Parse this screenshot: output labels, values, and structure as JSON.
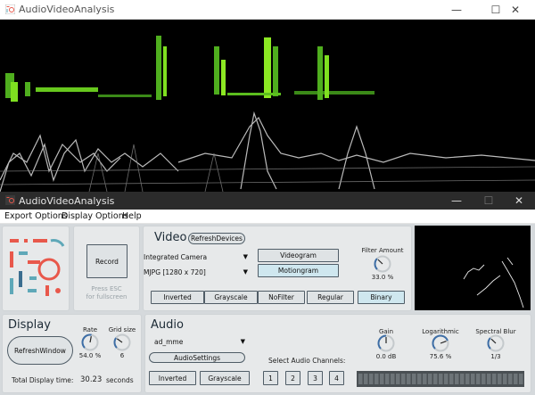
{
  "top_window": {
    "title": "AudioVideoAnalysis",
    "minimize": "—",
    "maximize": "☐",
    "close": "✕"
  },
  "bottom_window": {
    "title": "AudioVideoAnalysis",
    "minimize": "—",
    "maximize": "☐",
    "close": "✕"
  },
  "menu": [
    "Export Options",
    "Display Options",
    "Help"
  ],
  "record": {
    "label": "Record",
    "hint": "Press ESC\nfor fullscreen"
  },
  "video": {
    "title": "Video",
    "refresh_devices": "RefreshDevices",
    "camera": "Integrated Camera",
    "format": "MJPG [1280 x 720]",
    "videogram": "Videogram",
    "motiongram": "Motiongram",
    "filter_amount_label": "Filter Amount",
    "filter_amount_value": "33.0 %",
    "filter_amount_level": 0.33,
    "buttons": [
      "Inverted",
      "Grayscale",
      "NoFilter",
      "Regular",
      "Binary"
    ]
  },
  "display": {
    "title": "Display",
    "refresh_window": "RefreshWindow",
    "rate_label": "Rate",
    "rate_value": "54.0 %",
    "rate_level": 0.54,
    "grid_label": "Grid size",
    "grid_value": "6",
    "grid_level": 0.3,
    "total_label": "Total Display time:",
    "total_value": "30.23",
    "total_unit": "seconds"
  },
  "audio": {
    "title": "Audio",
    "driver": "ad_mme",
    "settings": "AudioSettings",
    "inverted": "Inverted",
    "grayscale": "Grayscale",
    "channels_label": "Select Audio Channels:",
    "channels": [
      "1",
      "2",
      "3",
      "4"
    ],
    "gain_label": "Gain",
    "gain_value": "0.0 dB",
    "gain_level": 0.5,
    "log_label": "Logarithmic",
    "log_value": "75.6 %",
    "log_level": 0.756,
    "blur_label": "Spectral Blur",
    "blur_value": "1/3",
    "blur_level": 0.33
  },
  "colors": {
    "accent_on": "#cfe7ef",
    "knob": "#3e6ea6",
    "logo_red": "#e8584b",
    "logo_teal": "#5fa8b8"
  }
}
